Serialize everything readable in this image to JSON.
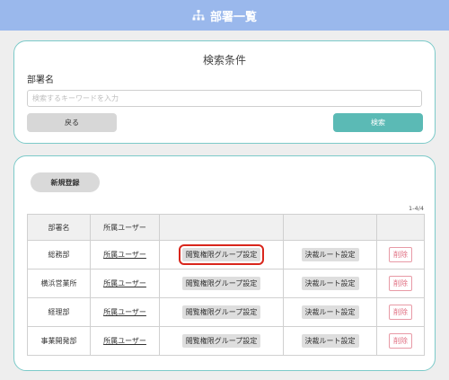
{
  "header": {
    "title": "部署一覧",
    "icon": "org-chart-icon"
  },
  "search": {
    "title": "検索条件",
    "field_label": "部署名",
    "placeholder": "検索するキーワードを入力",
    "value": "",
    "back_label": "戻る",
    "search_label": "検索"
  },
  "list": {
    "new_label": "新規登録",
    "count": "1-4/4",
    "columns": [
      "部署名",
      "所属ユーザー",
      "",
      "",
      ""
    ],
    "rows": [
      {
        "name": "総務部",
        "users_link": "所属ユーザー",
        "perm_btn": "閲覧権限グループ設定",
        "route_btn": "決裁ルート設定",
        "delete_btn": "削除"
      },
      {
        "name": "横浜営業所",
        "users_link": "所属ユーザー",
        "perm_btn": "閲覧権限グループ設定",
        "route_btn": "決裁ルート設定",
        "delete_btn": "削除"
      },
      {
        "name": "経理部",
        "users_link": "所属ユーザー",
        "perm_btn": "閲覧権限グループ設定",
        "route_btn": "決裁ルート設定",
        "delete_btn": "削除"
      },
      {
        "name": "事業開発部",
        "users_link": "所属ユーザー",
        "perm_btn": "閲覧権限グループ設定",
        "route_btn": "決裁ルート設定",
        "delete_btn": "削除"
      }
    ]
  },
  "colors": {
    "header": "#9ab8ec",
    "accent": "#5bbab5",
    "card_border": "#7ccac9",
    "highlight": "#d9261c",
    "delete": "#e06f82"
  }
}
